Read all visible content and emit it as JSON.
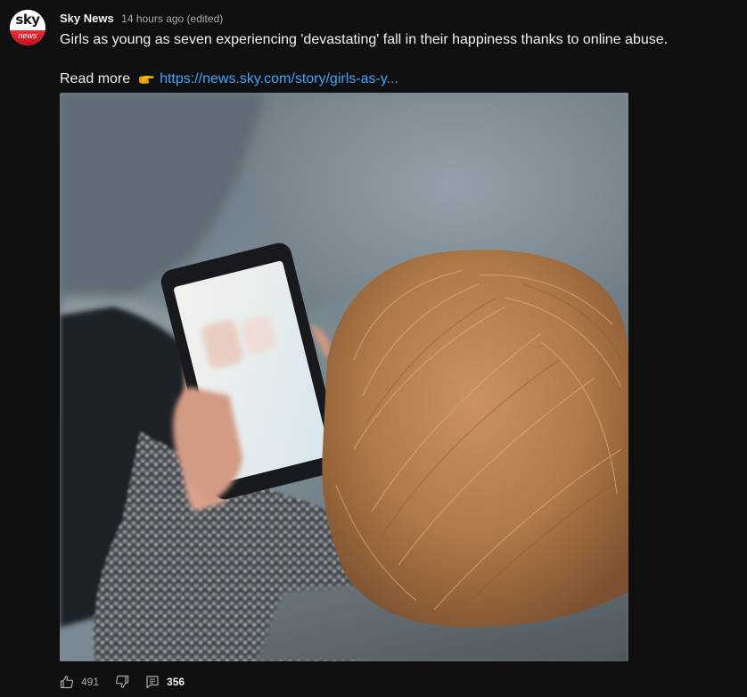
{
  "channel": {
    "avatar_top_text": "sky",
    "avatar_bottom_text": "news",
    "name": "Sky News",
    "timestamp": "14 hours ago (edited)"
  },
  "post": {
    "text": "Girls as young as seven experiencing 'devastating' fall in their happiness thanks to online abuse.",
    "read_more_label": "Read more",
    "pointing_icon": "backhand-index-pointing-right-icon",
    "link_text": "https://news.sky.com/story/girls-as-y..."
  },
  "image": {
    "subject": "child-with-smartphone"
  },
  "actions": {
    "like_count": "491",
    "comment_count": "356",
    "like_icon": "thumbs-up-icon",
    "dislike_icon": "thumbs-down-icon",
    "comment_icon": "comment-icon"
  },
  "colors": {
    "background": "#0f0f0f",
    "link": "#3ea6ff",
    "primary_text": "#f1f1f1",
    "secondary_text": "#aaaaaa",
    "brand_red": "#e8323c"
  }
}
